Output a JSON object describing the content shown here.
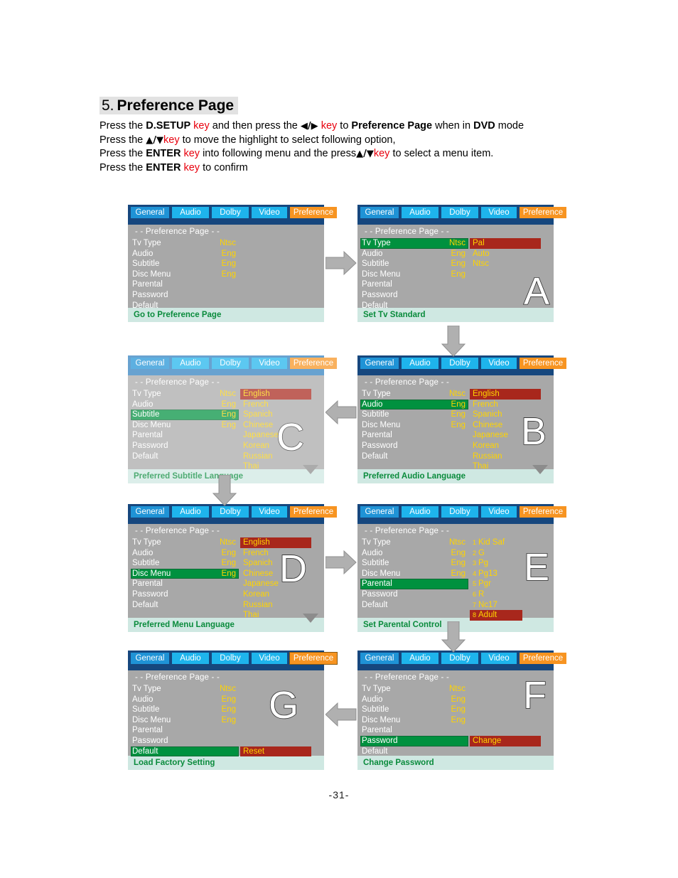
{
  "heading": {
    "number": "5.",
    "title": "Preference Page"
  },
  "instructions": {
    "line1_a": "Press the ",
    "line1_b": "D.SETUP",
    "line1_c": "key",
    "line1_d": " and then press the ",
    "line1_e": "◀/▶",
    "line1_f": "key",
    "line1_g": " to ",
    "line1_h": "Preference Page",
    "line1_i": " when in ",
    "line1_j": "DVD",
    "line1_k": " mode",
    "line2_a": "Press the ",
    "line2_b": "▲/▼",
    "line2_c": "key",
    "line2_d": " to move the highlight to select following option,",
    "line3_a": "Press the ",
    "line3_b": "ENTER",
    "line3_c": "key",
    "line3_d": " into following menu and the press",
    "line3_e": "▲/▼",
    "line3_f": "key",
    "line3_g": " to select a menu item.",
    "line4_a": "Press the ",
    "line4_b": "ENTER",
    "line4_c": "key",
    "line4_d": " to confirm"
  },
  "tabs": {
    "general": "General",
    "audio": "Audio",
    "dolby": "Dolby",
    "video": "Video",
    "preference": "Preference"
  },
  "page_label": "- -  Preference  Page - -",
  "menu_labels": {
    "tv_type": "Tv Type",
    "audio": "Audio",
    "subtitle": "Subtitle",
    "disc_menu": "Disc Menu",
    "parental": "Parental",
    "password": "Password",
    "default": "Default"
  },
  "menu_values": {
    "tv_type": "Ntsc",
    "audio": "Eng",
    "subtitle": "Eng",
    "disc_menu": "Eng"
  },
  "panels": {
    "start": {
      "letter": "",
      "footer": "Go to Preference Page"
    },
    "A": {
      "letter": "A",
      "footer": "Set Tv Standard",
      "highlight_row": "tv_type",
      "submenu": [
        "Pal",
        "Auto",
        "Ntsc"
      ],
      "submenu_selected": "Pal"
    },
    "B": {
      "letter": "B",
      "footer": "Preferred Audio Language",
      "highlight_row": "audio",
      "submenu": [
        "English",
        "French",
        "Spanich",
        "Chinese",
        "Japanese",
        "Korean",
        "Russian",
        "Thai"
      ],
      "submenu_selected": "English"
    },
    "C": {
      "letter": "C",
      "footer": "Preferred Subtitle Language",
      "highlight_row": "subtitle",
      "submenu": [
        "English",
        "French",
        "Spanich",
        "Chinese",
        "Japanese",
        "Korean",
        "Russian",
        "Thai"
      ],
      "submenu_selected": "English"
    },
    "D": {
      "letter": "D",
      "footer": "Preferred Menu Language",
      "highlight_row": "disc_menu",
      "submenu": [
        "English",
        "French",
        "Spanich",
        "Chinese",
        "Japanese",
        "Korean",
        "Russian",
        "Thai"
      ],
      "submenu_selected": "English"
    },
    "E": {
      "letter": "E",
      "footer": "Set Parental Control",
      "highlight_row": "parental",
      "ratings": [
        {
          "num": "1",
          "label": "Kid Saf"
        },
        {
          "num": "2",
          "label": "G"
        },
        {
          "num": "3",
          "label": "Pg"
        },
        {
          "num": "4",
          "label": "Pg13"
        },
        {
          "num": "5",
          "label": "Pgr"
        },
        {
          "num": "6",
          "label": "R"
        },
        {
          "num": "7",
          "label": "Nc17"
        },
        {
          "num": "8",
          "label": "Adult"
        }
      ],
      "rating_selected": "8 Adult"
    },
    "F": {
      "letter": "F",
      "footer": "Change Password",
      "highlight_row": "password",
      "action": "Change"
    },
    "G": {
      "letter": "G",
      "footer": "Load Factory Setting",
      "highlight_row": "default",
      "action": "Reset"
    }
  },
  "colors": {
    "osd_bg": "#a8a8a8",
    "tabbar": "#16477e",
    "tab": "#1eb4ec",
    "tab_preference": "#f79421",
    "highlight_green": "#00913f",
    "highlight_red": "#a8271c",
    "value_yellow": "#ffd400",
    "footer_bg": "#cfe8e2",
    "footer_text": "#0a8b3c",
    "accent_red": "#e8000d"
  },
  "page_number": "-31-"
}
